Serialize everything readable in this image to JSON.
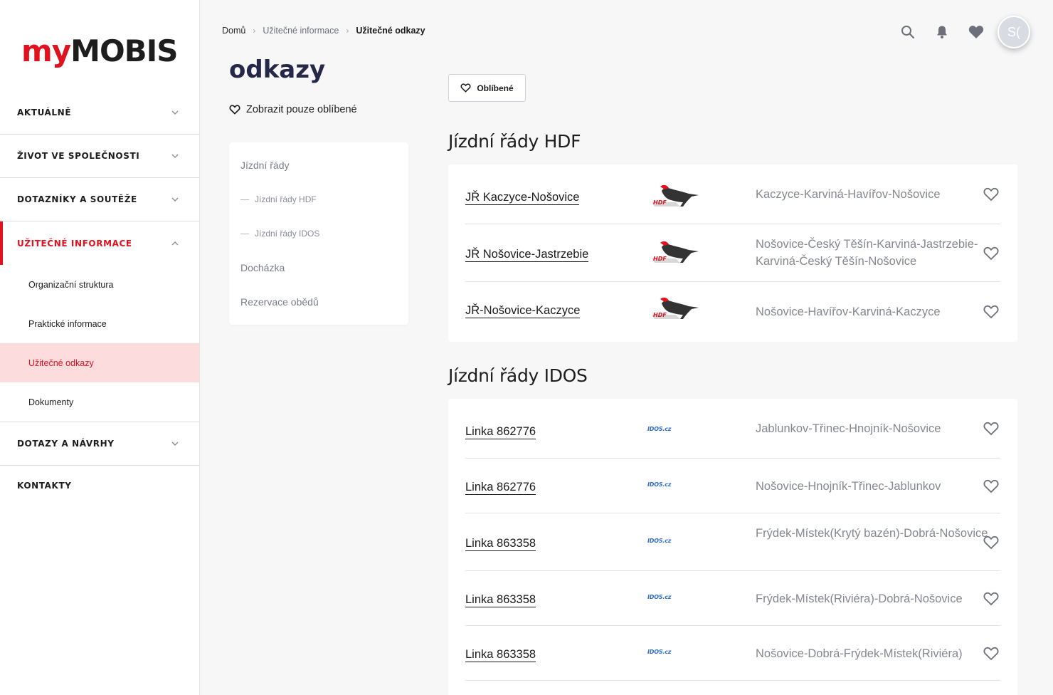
{
  "brand": {
    "logo_my": "my",
    "logo_mobis": "MOBIS",
    "accent": "#e0121f"
  },
  "sidebar": {
    "items": [
      {
        "label": "AKTUÁLNĚ",
        "chevron": "down"
      },
      {
        "label": "ŽIVOT VE SPOLEČNOSTI",
        "chevron": "down"
      },
      {
        "label": "DOTAZNÍKY A SOUTĚŽE",
        "chevron": "down"
      },
      {
        "label": "UŽITEČNÉ INFORMACE",
        "chevron": "up",
        "active": true
      }
    ],
    "sub_items": [
      {
        "label": "Organizační struktura"
      },
      {
        "label": "Praktické informace"
      },
      {
        "label": "Užitečné odkazy",
        "current": true
      },
      {
        "label": "Dokumenty"
      }
    ],
    "after_items": [
      {
        "label": "DOTAZY A NÁVRHY",
        "chevron": "down"
      },
      {
        "label": "KONTAKTY"
      }
    ]
  },
  "breadcrumb": {
    "home": "Domů",
    "parent": "Užitečné informace",
    "current": "Užitečné odkazy"
  },
  "header": {
    "avatar_initials": "S(",
    "icons": [
      "search-icon",
      "bell-icon",
      "heart-icon"
    ]
  },
  "page": {
    "title": "odkazy",
    "fav_toggle_label": "Zobrazit pouze oblíbené"
  },
  "toc": {
    "items": [
      {
        "label": "Jízdní řády"
      },
      {
        "label": "Jízdní řády HDF"
      },
      {
        "label": "Jízdní řády IDOS"
      },
      {
        "label": "Docházka"
      },
      {
        "label": "Rezervace obědů"
      }
    ]
  },
  "favorites_button": {
    "label": "Oblíbené"
  },
  "sections": [
    {
      "title": "Jízdní řády HDF",
      "logo": "HDF",
      "rows": [
        {
          "link": "JŘ Kaczyce-Nošovice",
          "desc": "Kaczyce-Karviná-Havířov-Nošovice"
        },
        {
          "link": "JŘ Nošovice-Jastrzebie",
          "desc": "Nošovice-Český Těšín-Karviná-Jastrzebie-Karviná-Český Těšín-Nošovice"
        },
        {
          "link": "JŘ-Nošovice-Kaczyce",
          "desc": "Nošovice-Havířov-Karviná-Kaczyce"
        }
      ]
    },
    {
      "title": "Jízdní řády IDOS",
      "logo": "IDOS.cz",
      "rows": [
        {
          "link": "Linka 862776",
          "desc": "Jablunkov-Třinec-Hnojník-Nošovice"
        },
        {
          "link": "Linka 862776",
          "desc": "Nošovice-Hnojník-Třinec-Jablunkov"
        },
        {
          "link": "Linka 863358",
          "desc": "Frýdek-Místek(Krytý bazén)-Dobrá-Nošovice"
        },
        {
          "link": "Linka 863358",
          "desc": "Frýdek-Místek(Riviéra)-Dobrá-Nošovice"
        },
        {
          "link": "Linka 863358",
          "desc": "Nošovice-Dobrá-Frýdek-Místek(Riviéra)"
        }
      ]
    }
  ]
}
